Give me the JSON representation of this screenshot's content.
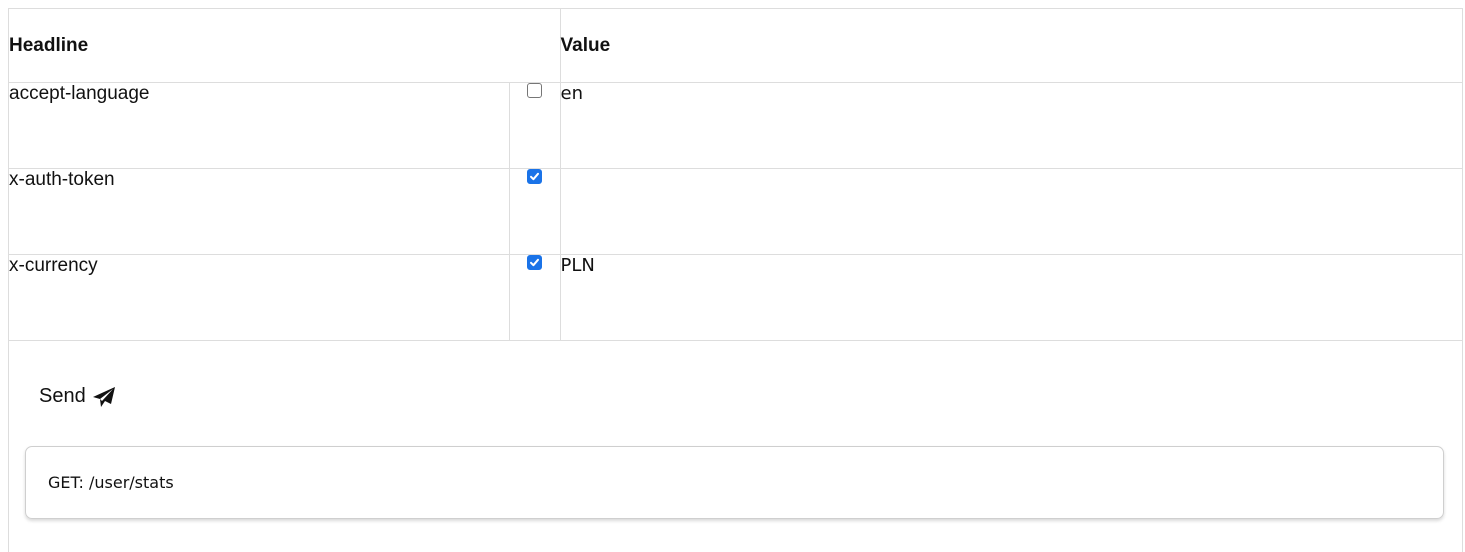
{
  "table": {
    "header_name": "Headline",
    "header_value": "Value",
    "rows": [
      {
        "name": "accept-language",
        "checked": false,
        "value": "en"
      },
      {
        "name": "x-auth-token",
        "checked": true,
        "value": ""
      },
      {
        "name": "x-currency",
        "checked": true,
        "value": "PLN"
      }
    ]
  },
  "send": {
    "label": "Send",
    "icon": "paper-plane-icon"
  },
  "request": {
    "text": "GET: /user/stats"
  },
  "colors": {
    "checkbox_accent": "#1a73e8",
    "border": "#dddddd"
  }
}
